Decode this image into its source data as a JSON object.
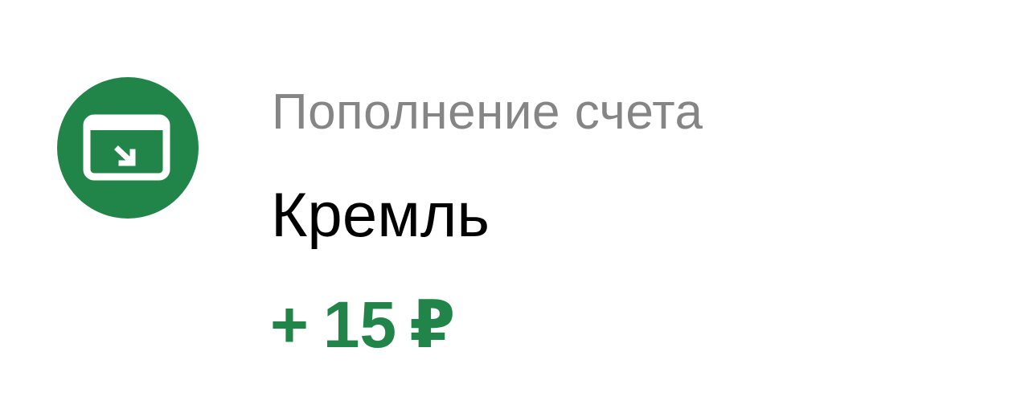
{
  "transaction": {
    "icon": "card-incoming-icon",
    "category": "Пополнение счета",
    "merchant": "Кремль",
    "amount": {
      "sign": "+",
      "value": "15",
      "currency": "₽"
    }
  },
  "colors": {
    "accent_green": "#21854a",
    "category_gray": "#858585",
    "merchant_black": "#000000"
  }
}
